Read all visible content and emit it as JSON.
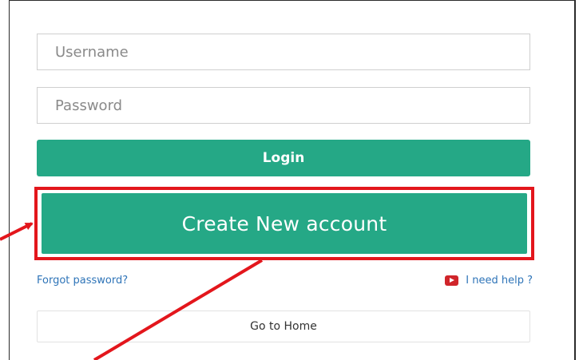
{
  "form": {
    "username_placeholder": "Username",
    "password_placeholder": "Password",
    "login_label": "Login",
    "create_account_label": "Create New account",
    "forgot_password_label": "Forgot password?",
    "help_label": "I need help ?",
    "help_icon": "youtube-play-icon",
    "home_label": "Go to Home"
  },
  "colors": {
    "accent_green": "#25a886",
    "highlight_red": "#e3161c",
    "link_blue": "#2e74b8"
  }
}
